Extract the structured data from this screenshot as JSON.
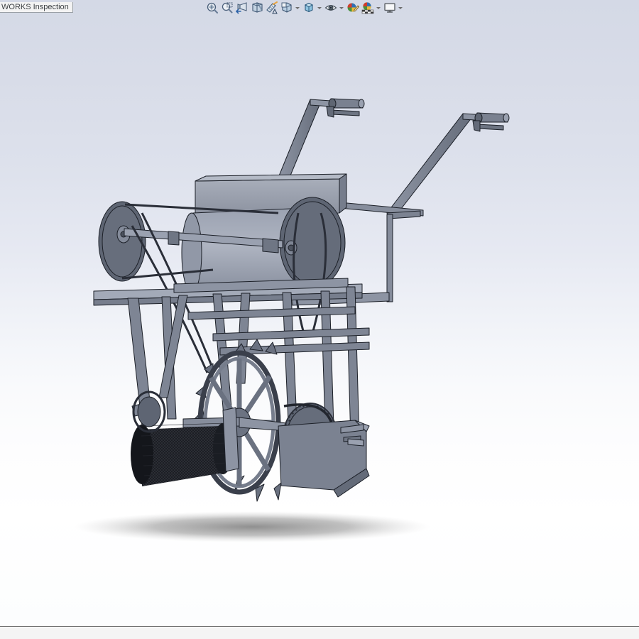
{
  "window": {
    "app_name": "SOLIDWORKS",
    "tab_label": "WORKS Inspection"
  },
  "toolbar": {
    "name": "heads-up-view-toolbar",
    "items": [
      {
        "id": "zoom-to-fit",
        "label": "Zoom to Fit",
        "icon": "zoom-to-fit-icon",
        "has_caret": false
      },
      {
        "id": "zoom-to-area",
        "label": "Zoom to Area",
        "icon": "zoom-to-area-icon",
        "has_caret": false
      },
      {
        "id": "previous-view",
        "label": "Previous View",
        "icon": "previous-view-icon",
        "has_caret": false
      },
      {
        "id": "section-view",
        "label": "Section View",
        "icon": "section-view-icon",
        "has_caret": false
      },
      {
        "id": "view-orientation-paint",
        "label": "View Orientation",
        "icon": "measure-icon",
        "has_caret": false
      },
      {
        "id": "display-style",
        "label": "Display Style",
        "icon": "display-style-icon",
        "has_caret": true
      },
      {
        "id": "view-orientation",
        "label": "View Orientation",
        "icon": "view-cube-icon",
        "has_caret": true
      },
      {
        "id": "hide-show-items",
        "label": "Hide/Show Items",
        "icon": "eye-icon",
        "has_caret": true
      },
      {
        "id": "edit-appearance",
        "label": "Edit Appearance",
        "icon": "appearance-ball-pencil-icon",
        "has_caret": false
      },
      {
        "id": "apply-scene",
        "label": "Apply Scene",
        "icon": "apply-scene-icon",
        "has_caret": true
      },
      {
        "id": "view-settings",
        "label": "View Settings",
        "icon": "monitor-icon",
        "has_caret": true
      }
    ]
  },
  "statusbar": {
    "text": ""
  },
  "model": {
    "name": "walk-behind-sweeper-assembly",
    "display_mode": "Shaded With Edges",
    "colors": {
      "metal_light": "#9aa1b0",
      "metal_mid": "#7e8595",
      "metal_dark": "#5d6472",
      "metal_darker": "#4a505c",
      "edge": "#1c2028",
      "brush_dark": "#15171c",
      "shadow": "#8a8a8a"
    },
    "components": [
      {
        "name": "left-handlebar-grip",
        "type": "handle"
      },
      {
        "name": "right-handlebar-grip",
        "type": "handle"
      },
      {
        "name": "handlebar-frame",
        "type": "frame"
      },
      {
        "name": "engine-cover-box",
        "type": "housing"
      },
      {
        "name": "engine-drum",
        "type": "cylinder"
      },
      {
        "name": "left-pulley",
        "type": "pulley"
      },
      {
        "name": "right-pulley",
        "type": "pulley"
      },
      {
        "name": "drive-belt",
        "type": "belt"
      },
      {
        "name": "platform-plate",
        "type": "plate"
      },
      {
        "name": "support-struts",
        "type": "frame"
      },
      {
        "name": "lug-wheel",
        "type": "spoked-wheel"
      },
      {
        "name": "brush-roller",
        "type": "brush"
      },
      {
        "name": "chain-sprocket",
        "type": "sprocket"
      },
      {
        "name": "drive-chain",
        "type": "chain"
      },
      {
        "name": "collector-hopper",
        "type": "housing"
      },
      {
        "name": "floor-shadow",
        "type": "shadow"
      }
    ]
  }
}
